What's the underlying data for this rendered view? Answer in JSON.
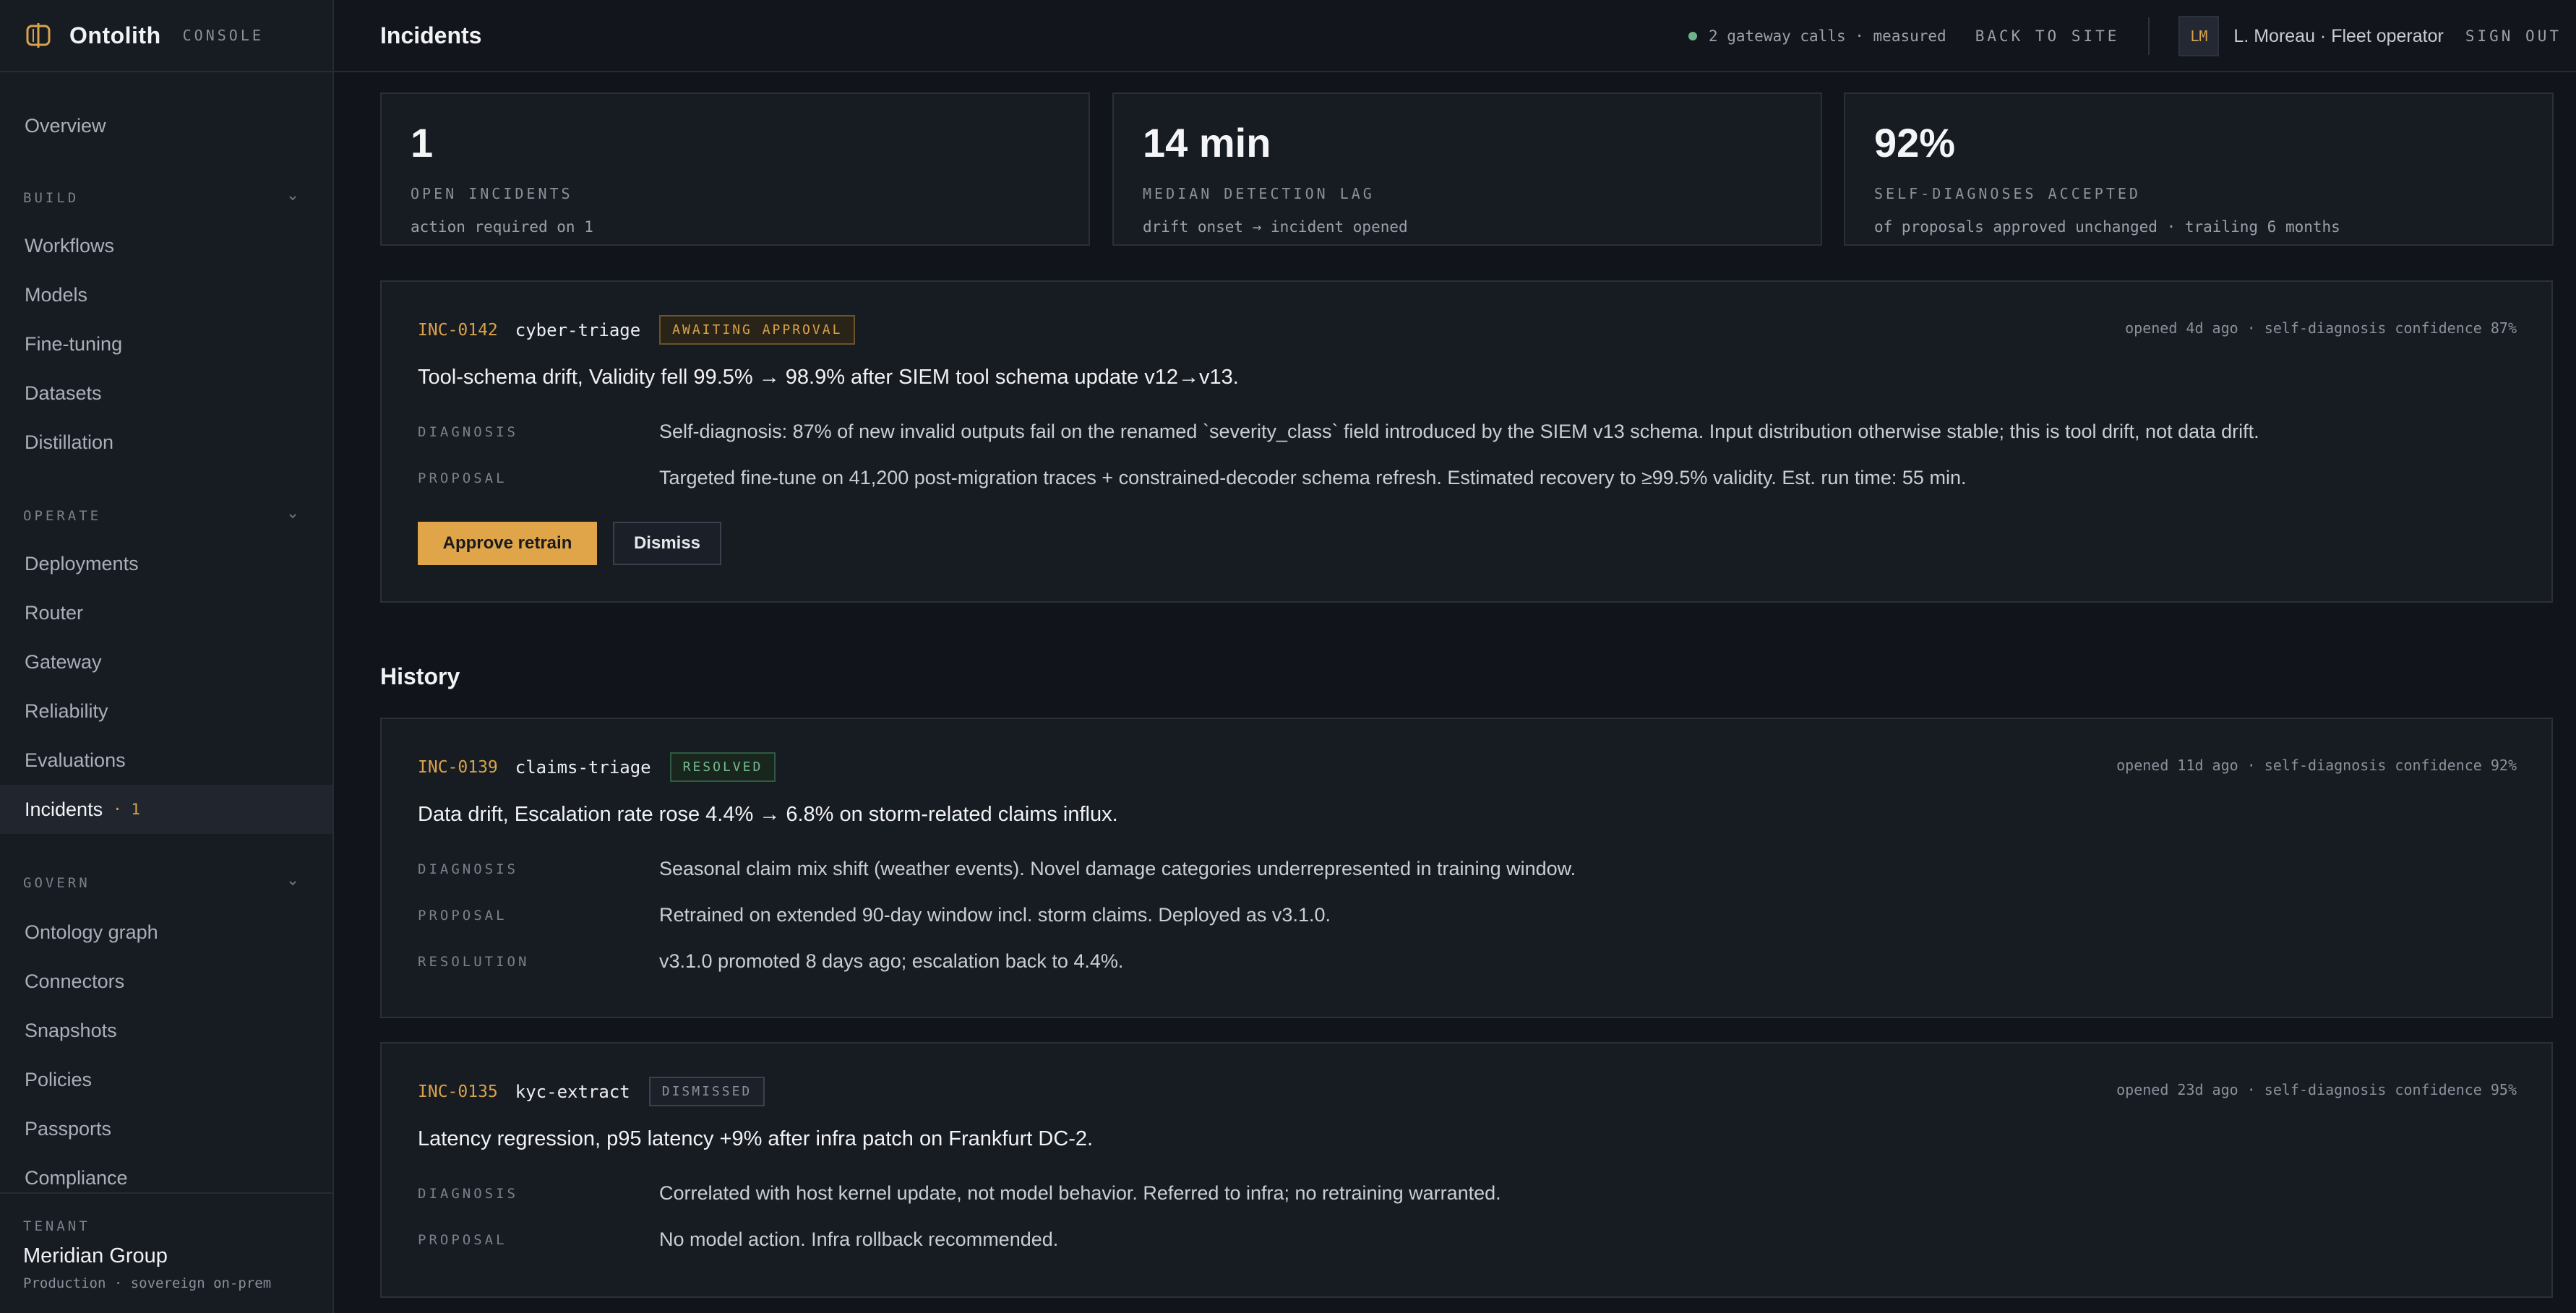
{
  "brand": {
    "name": "Ontolith",
    "tag": "CONSOLE"
  },
  "header": {
    "title": "Incidents",
    "gateway_status": "2 gateway calls · measured",
    "back_link": "BACK TO SITE",
    "avatar_initials": "LM",
    "user": "L. Moreau · Fleet operator",
    "sign_out": "SIGN OUT",
    "status_color": "#6fb38b"
  },
  "sidebar": {
    "overview": "Overview",
    "sections": {
      "build": "BUILD",
      "operate": "OPERATE",
      "govern": "GOVERN"
    },
    "build_items": [
      "Workflows",
      "Models",
      "Fine-tuning",
      "Datasets",
      "Distillation"
    ],
    "operate_items": [
      "Deployments",
      "Router",
      "Gateway",
      "Reliability",
      "Evaluations",
      "Incidents"
    ],
    "incidents_count": "· 1",
    "govern_items": [
      "Ontology graph",
      "Connectors",
      "Snapshots",
      "Policies",
      "Passports",
      "Compliance"
    ],
    "tenant": {
      "label": "TENANT",
      "name": "Meridian Group",
      "sub": "Production · sovereign on-prem"
    }
  },
  "stats": [
    {
      "value": "1",
      "label": "OPEN INCIDENTS",
      "sub": "action required on 1"
    },
    {
      "value": "14 min",
      "label": "MEDIAN DETECTION LAG",
      "sub": "drift onset → incident opened"
    },
    {
      "value": "92%",
      "label": "SELF-DIAGNOSES ACCEPTED",
      "sub": "of proposals approved unchanged · trailing 6 months"
    }
  ],
  "open_incident": {
    "id": "INC-0142",
    "model": "cyber-triage",
    "status": "AWAITING APPROVAL",
    "meta": "opened 4d ago · self-diagnosis confidence 87%",
    "title": "Tool-schema drift, Validity fell 99.5% → 98.9% after SIEM tool schema update v12→v13.",
    "diagnosis_label": "DIAGNOSIS",
    "diagnosis": "Self-diagnosis: 87% of new invalid outputs fail on the renamed `severity_class` field introduced by the SIEM v13 schema. Input distribution otherwise stable; this is tool drift, not data drift.",
    "proposal_label": "PROPOSAL",
    "proposal": "Targeted fine-tune on 41,200 post-migration traces + constrained-decoder schema refresh. Estimated recovery to ≥99.5% validity. Est. run time: 55 min.",
    "approve_label": "Approve retrain",
    "dismiss_label": "Dismiss"
  },
  "history_title": "History",
  "history": [
    {
      "id": "INC-0139",
      "model": "claims-triage",
      "status": "RESOLVED",
      "meta": "opened 11d ago · self-diagnosis confidence 92%",
      "title": "Data drift, Escalation rate rose 4.4% → 6.8% on storm-related claims influx.",
      "diagnosis_label": "DIAGNOSIS",
      "diagnosis": "Seasonal claim mix shift (weather events). Novel damage categories underrepresented in training window.",
      "proposal_label": "PROPOSAL",
      "proposal": "Retrained on extended 90-day window incl. storm claims. Deployed as v3.1.0.",
      "resolution_label": "RESOLUTION",
      "resolution": "v3.1.0 promoted 8 days ago; escalation back to 4.4%."
    },
    {
      "id": "INC-0135",
      "model": "kyc-extract",
      "status": "DISMISSED",
      "meta": "opened 23d ago · self-diagnosis confidence 95%",
      "title": "Latency regression, p95 latency +9% after infra patch on Frankfurt DC-2.",
      "diagnosis_label": "DIAGNOSIS",
      "diagnosis": "Correlated with host kernel update, not model behavior. Referred to infra; no retraining warranted.",
      "proposal_label": "PROPOSAL",
      "proposal": "No model action. Infra rollback recommended."
    }
  ]
}
